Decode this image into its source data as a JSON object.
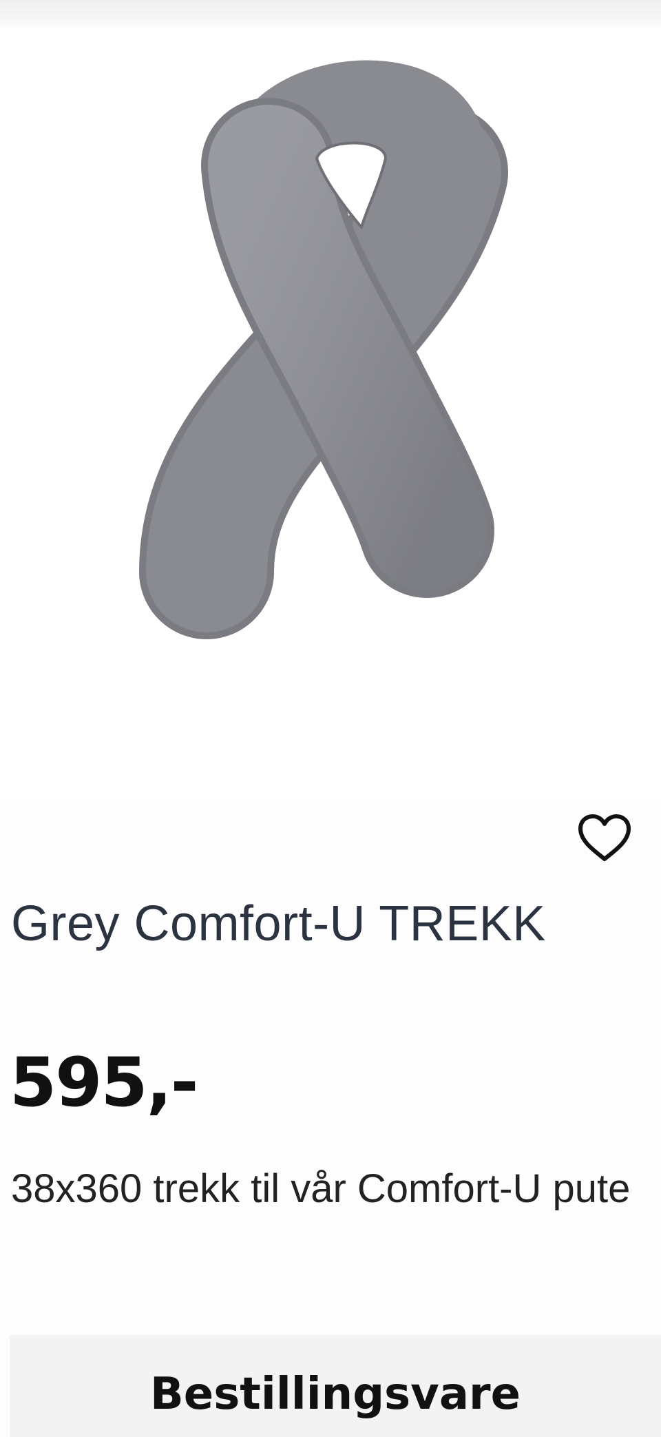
{
  "product": {
    "image_alt": "Grey Comfort-U TREKK",
    "title": "Grey Comfort-U TREKK",
    "price": "595,-",
    "description": "38x360 trekk til vår Comfort-U pute",
    "availability_label": "Bestillingsvare",
    "wishlist_icon": "heart-outline-icon"
  },
  "colors": {
    "pillow": "#8d8e94",
    "title_text": "#2c3340",
    "order_box_bg": "#f3f3f3"
  }
}
